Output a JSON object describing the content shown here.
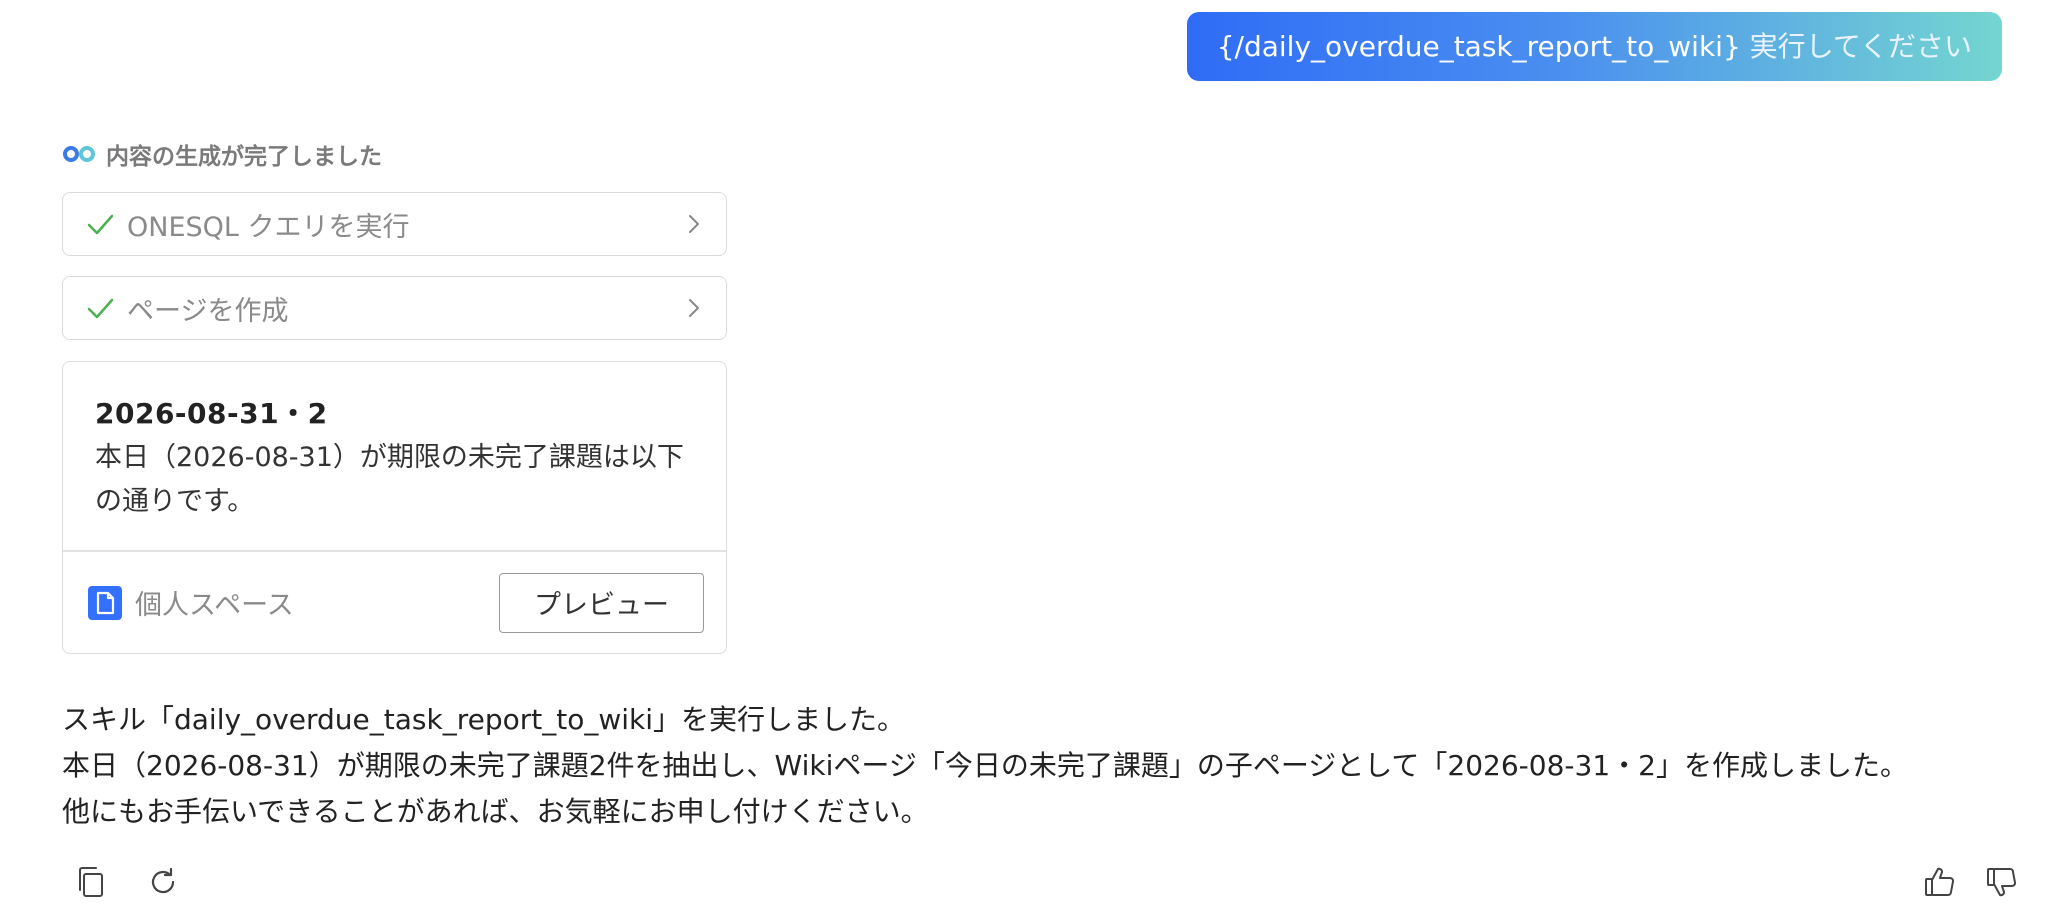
{
  "user_message": {
    "command": "{/daily_overdue_task_report_to_wiki}",
    "text": " 実行してください"
  },
  "status": {
    "text": "内容の生成が完了しました",
    "icon": "infinity-logo-icon"
  },
  "steps": [
    {
      "label": "ONESQL クエリを実行",
      "icon": "check-icon"
    },
    {
      "label": "ページを作成",
      "icon": "check-icon"
    }
  ],
  "page_card": {
    "title": "2026-08-31・2",
    "description": "本日（2026-08-31）が期限の未完了課題は以下の通りです。",
    "space_label": "個人スペース",
    "preview_label": "プレビュー"
  },
  "reply": {
    "line1": "スキル「daily_overdue_task_report_to_wiki」を実行しました。",
    "line2": "本日（2026-08-31）が期限の未完了課題2件を抽出し、Wikiページ「今日の未完了課題」の子ページとして「2026-08-31・2」を作成しました。",
    "line3": "他にもお手伝いできることがあれば、お気軽にお申し付けください。"
  },
  "actions": [
    "copy-icon",
    "regenerate-icon",
    "thumbs-up-icon",
    "thumbs-down-icon"
  ],
  "colors": {
    "bubble_start": "#2f6cf6",
    "bubble_end": "#74d6d0",
    "check": "#4caf50",
    "doc_icon": "#3370ff"
  }
}
